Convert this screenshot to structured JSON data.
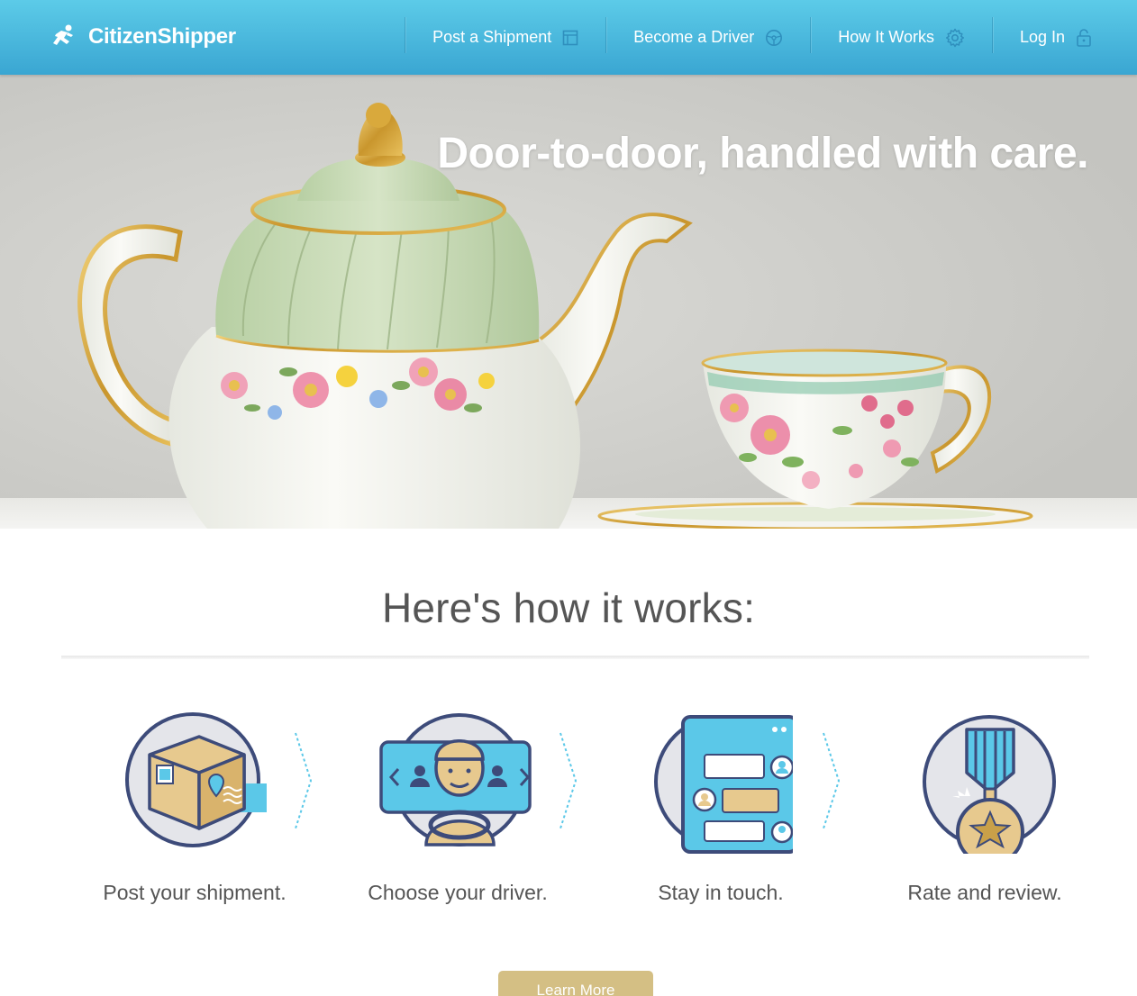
{
  "header": {
    "logo_text": "CitizenShipper",
    "nav": [
      {
        "label": "Post a Shipment",
        "icon": "form-icon"
      },
      {
        "label": "Become a Driver",
        "icon": "steering-wheel-icon"
      },
      {
        "label": "How It Works",
        "icon": "gear-icon"
      },
      {
        "label": "Log In",
        "icon": "lock-icon"
      }
    ]
  },
  "hero": {
    "title": "Door-to-door, handled with care."
  },
  "how_it_works": {
    "title": "Here's how it works:",
    "steps": [
      {
        "label": "Post your shipment.",
        "icon": "package-icon"
      },
      {
        "label": "Choose your driver.",
        "icon": "driver-icon"
      },
      {
        "label": "Stay in touch.",
        "icon": "chat-icon"
      },
      {
        "label": "Rate and review.",
        "icon": "medal-icon"
      }
    ],
    "cta_label": "Learn More"
  },
  "colors": {
    "header_top": "#5ccbe8",
    "header_bottom": "#3aa6d2",
    "accent_blue": "#5bc8e8",
    "accent_gold": "#d4bf84",
    "navy": "#3d4b7a"
  }
}
